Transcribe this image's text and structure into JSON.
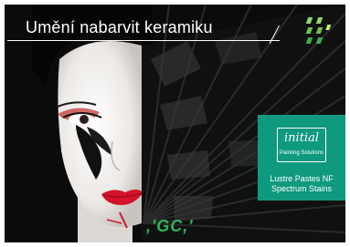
{
  "headline": "Umění nabarvit keramiku",
  "product": {
    "logo_name": "initial",
    "logo_tagline": "Painting Solutions",
    "line1": "Lustre Pastes NF",
    "line2": "Spectrum Stains"
  },
  "brand": {
    "logo_text": ",'GC,'"
  },
  "colors": {
    "card_green": "#0f9a7f",
    "gc_green": "#2fb45a",
    "lips_red": "#d4122a"
  }
}
